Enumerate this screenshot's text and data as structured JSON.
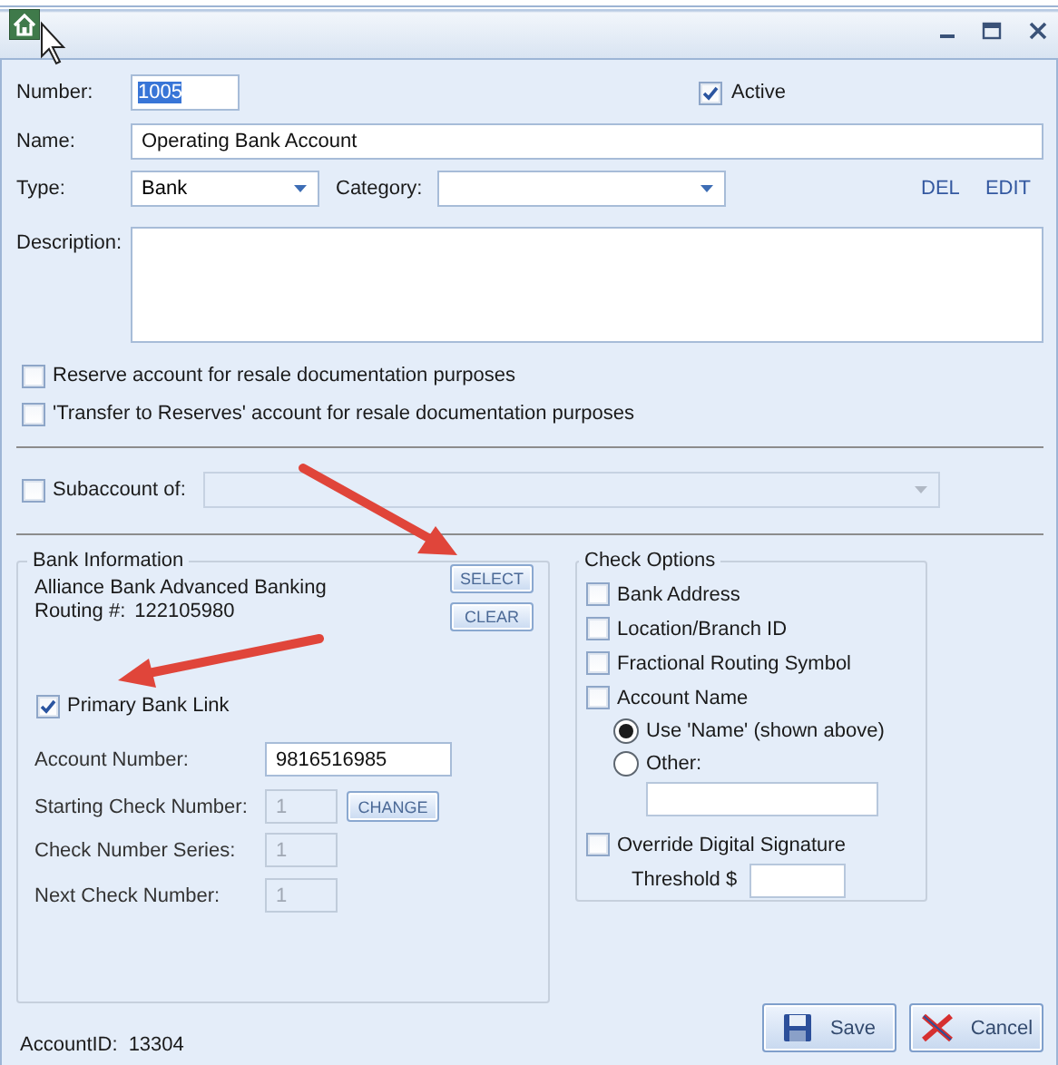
{
  "header": {
    "number": {
      "label": "Number:",
      "value": "1005",
      "highlighted": true
    },
    "active": {
      "label": "Active",
      "checked": true
    }
  },
  "name": {
    "label": "Name:",
    "value": "Operating Bank Account"
  },
  "type": {
    "label": "Type:",
    "value": "Bank"
  },
  "category": {
    "label": "Category:"
  },
  "links": [
    "DEL",
    "EDIT"
  ],
  "description": {
    "label": "Description:"
  },
  "options": [
    {
      "label": "Reserve account for resale documentation purposes",
      "checked": false
    },
    {
      "label": "'Transfer to Reserves' account for resale documentation purposes",
      "checked": false
    }
  ],
  "subaccount": {
    "label": "Subaccount of:",
    "checked": false,
    "disabled": true
  },
  "bank_information": {
    "title": "Bank Information",
    "bank_name": "Alliance Bank Advanced Banking",
    "routing_label": "Routing #:",
    "routing": "122105980",
    "buttons": [
      "SELECT",
      "CLEAR"
    ],
    "primary_link": {
      "label": "Primary Bank Link",
      "checked": true
    },
    "fields": [
      {
        "label": "Account Number:",
        "value": "9816516985",
        "disabled": false
      },
      {
        "label": "Starting Check Number:",
        "value": "1",
        "disabled": true,
        "button": "CHANGE"
      },
      {
        "label": "Check Number Series:",
        "value": "1",
        "disabled": true
      },
      {
        "label": "Next Check Number:",
        "value": "1",
        "disabled": true
      }
    ]
  },
  "check_options": {
    "title": "Check Options",
    "items": [
      {
        "kind": "checkbox",
        "label": "Bank Address",
        "checked": false
      },
      {
        "kind": "checkbox",
        "label": "Location/Branch ID",
        "checked": false
      },
      {
        "kind": "checkbox",
        "label": "Fractional Routing Symbol",
        "checked": false
      },
      {
        "kind": "checkbox",
        "label": "Account Name",
        "checked": false
      },
      {
        "kind": "radio",
        "label": "Use 'Name' (shown above)",
        "selected": true
      },
      {
        "kind": "radio",
        "label": "Other:",
        "selected": false
      },
      {
        "kind": "field"
      },
      {
        "kind": "checkbox",
        "label": "Override Digital Signature",
        "checked": false
      },
      {
        "kind": "amount",
        "label": "Threshold $"
      }
    ]
  },
  "footer": {
    "account_id_label": "AccountID:",
    "account_id": "13304"
  },
  "buttons": [
    {
      "kind": "save",
      "label": "Save"
    },
    {
      "kind": "cancel",
      "label": "Cancel"
    }
  ]
}
